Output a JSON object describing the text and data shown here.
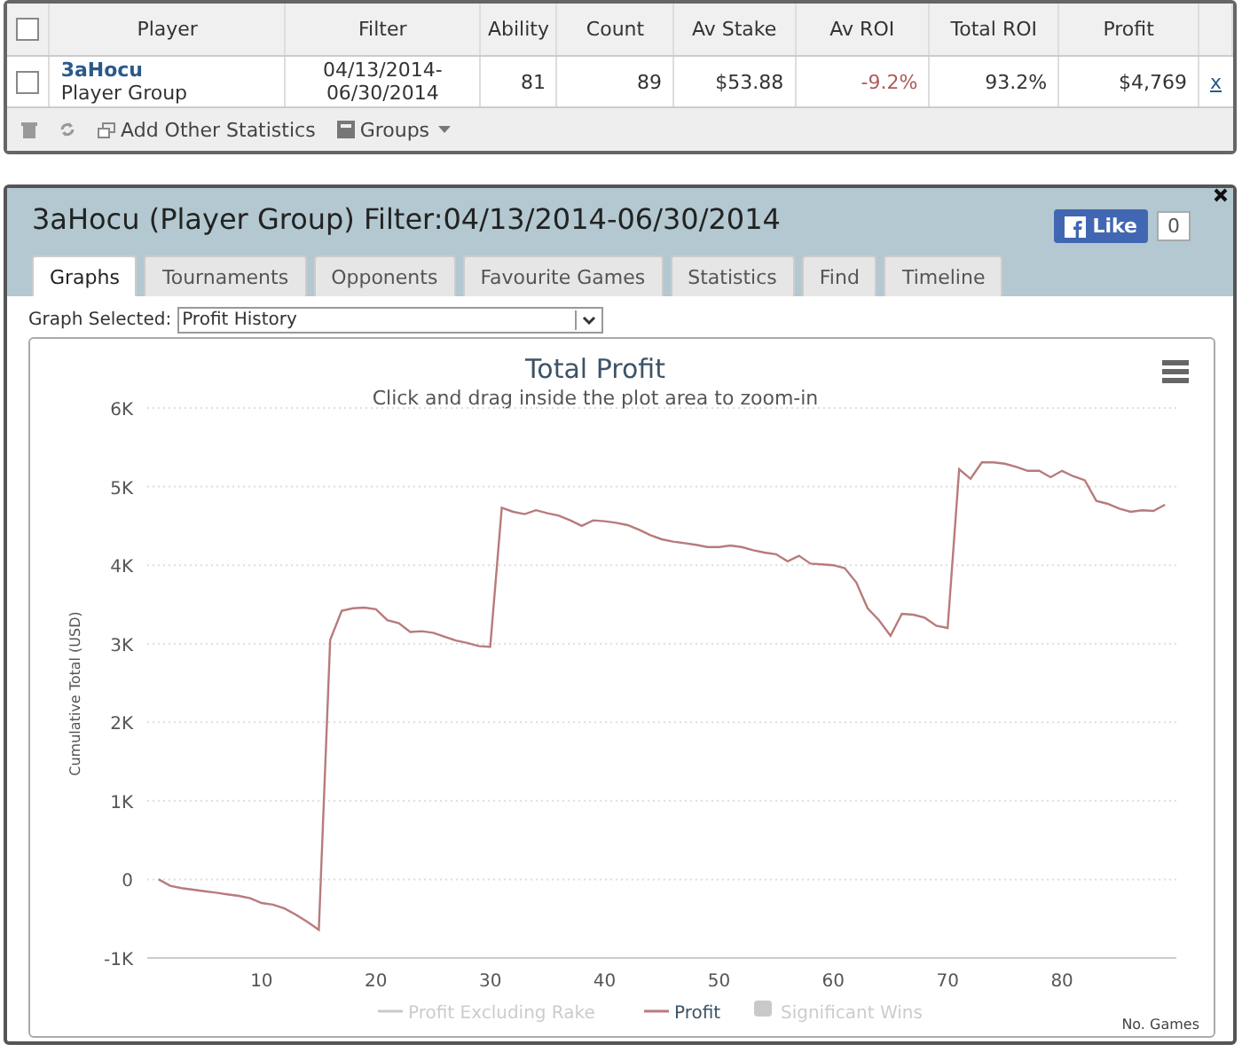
{
  "stats_table": {
    "columns": [
      {
        "label": "Player"
      },
      {
        "label": "Filter"
      },
      {
        "label": "Ability"
      },
      {
        "label": "Count"
      },
      {
        "label": "Av Stake"
      },
      {
        "label": "Av ROI"
      },
      {
        "label": "Total ROI"
      },
      {
        "label": "Profit"
      }
    ],
    "rows": [
      {
        "checked": false,
        "player": "3aHocu",
        "player_type": "Player Group",
        "filter": "04/13/2014-\n06/30/2014",
        "ability": "81",
        "count": "89",
        "av_stake": "$53.88",
        "av_roi": "-9.2%",
        "av_roi_negative": true,
        "total_roi": "93.2%",
        "profit": "$4,769",
        "remove": "x"
      }
    ],
    "header_checked": false,
    "toolbar": [
      {
        "kind": "delete"
      },
      {
        "kind": "refresh"
      },
      {
        "kind": "add",
        "label": "Add Other Statistics"
      },
      {
        "kind": "groups",
        "label": "Groups"
      }
    ]
  },
  "panel": {
    "title": "3aHocu (Player Group) Filter:04/13/2014-06/30/2014",
    "like": {
      "label": "Like",
      "count": "0"
    },
    "tabs": [
      {
        "label": "Graphs",
        "selected": true
      },
      {
        "label": "Tournaments",
        "selected": false
      },
      {
        "label": "Opponents",
        "selected": false
      },
      {
        "label": "Favourite Games",
        "selected": false
      },
      {
        "label": "Statistics",
        "selected": false
      },
      {
        "label": "Find",
        "selected": false
      },
      {
        "label": "Timeline",
        "selected": false
      }
    ],
    "graph_select": {
      "label": "Graph Selected:",
      "value": "Profit History"
    },
    "chart": {
      "subtitle": "Click and drag inside the plot area to zoom-in",
      "legend": [
        {
          "name": "Profit Excluding Rake",
          "kind": "line",
          "visible": false,
          "color": "#c9c9c9"
        },
        {
          "kind": "series_line",
          "visible": true
        },
        {
          "name": "Significant Wins",
          "kind": "box",
          "visible": false,
          "color": "#c9c9c9"
        }
      ],
      "chart_data": {
        "type": "line",
        "title": "Total Profit",
        "xlabel": "No. Games",
        "ylabel": "Cumulative Total (USD)",
        "x": [
          1,
          2,
          3,
          4,
          5,
          6,
          7,
          8,
          9,
          10,
          11,
          12,
          13,
          14,
          15,
          16,
          17,
          18,
          19,
          20,
          21,
          22,
          23,
          24,
          25,
          26,
          27,
          28,
          29,
          30,
          31,
          32,
          33,
          34,
          35,
          36,
          37,
          38,
          39,
          40,
          41,
          42,
          43,
          44,
          45,
          46,
          47,
          48,
          49,
          50,
          51,
          52,
          53,
          54,
          55,
          56,
          57,
          58,
          59,
          60,
          61,
          62,
          63,
          64,
          65,
          66,
          67,
          68,
          69,
          70,
          71,
          72,
          73,
          74,
          75,
          76,
          77,
          78,
          79,
          80,
          81,
          82,
          83,
          84,
          85,
          86,
          87,
          88,
          89
        ],
        "series": [
          {
            "name": "Profit",
            "color": "#b87b7b",
            "values": [
              0,
              -80,
              -110,
              -130,
              -150,
              -170,
              -190,
              -210,
              -240,
              -300,
              -320,
              -370,
              -450,
              -540,
              -640,
              3050,
              3420,
              3450,
              3460,
              3440,
              3300,
              3260,
              3150,
              3160,
              3140,
              3090,
              3040,
              3010,
              2970,
              2960,
              4730,
              4680,
              4650,
              4700,
              4660,
              4630,
              4570,
              4500,
              4570,
              4560,
              4540,
              4510,
              4450,
              4380,
              4330,
              4300,
              4280,
              4260,
              4230,
              4230,
              4250,
              4230,
              4190,
              4160,
              4140,
              4050,
              4120,
              4020,
              4010,
              4000,
              3960,
              3780,
              3450,
              3300,
              3100,
              3380,
              3370,
              3330,
              3230,
              3200,
              5220,
              5100,
              5310,
              5310,
              5290,
              5250,
              5200,
              5200,
              5120,
              5200,
              5130,
              5080,
              4820,
              4780,
              4720,
              4680,
              4700,
              4690,
              4770
            ]
          }
        ],
        "xlim": [
          0,
          90
        ],
        "ylim": [
          -1000,
          6000
        ],
        "grid": true,
        "xticks": [
          10,
          20,
          30,
          40,
          50,
          60,
          70,
          80
        ],
        "yticks": [
          {
            "value": -1000,
            "label": "-1K"
          },
          {
            "value": 0,
            "label": "0"
          },
          {
            "value": 1000,
            "label": "1K"
          },
          {
            "value": 2000,
            "label": "2K"
          },
          {
            "value": 3000,
            "label": "3K"
          },
          {
            "value": 4000,
            "label": "4K"
          },
          {
            "value": 5000,
            "label": "5K"
          },
          {
            "value": 6000,
            "label": "6K"
          }
        ]
      }
    }
  }
}
